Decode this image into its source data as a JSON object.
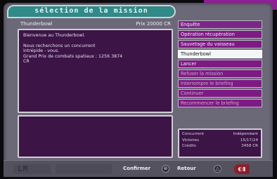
{
  "screen": {
    "title": "sélection de la mission"
  },
  "mission": {
    "name": "Thunderbowl",
    "prize": "Prix 20000 CR",
    "description": [
      "Bienvenue au Thunderbowl.",
      "Nous recherchons un concurrent\nintrépide - vous.\nGrand Prix de combats spatiaux : 1256 3874\nCR"
    ]
  },
  "menu": {
    "items": [
      {
        "label": "Enquête",
        "state": "header"
      },
      {
        "label": "Opération récupération",
        "state": "normal"
      },
      {
        "label": "Sauvetage du vaisseau",
        "state": "normal"
      },
      {
        "label": "Thunderbowl",
        "state": "active"
      },
      {
        "label": "Lancer",
        "state": "normal"
      },
      {
        "label": "Refuser la mission",
        "state": "dim"
      },
      {
        "label": "Interrompre le briefing",
        "state": "dim"
      },
      {
        "label": "Continuer",
        "state": "dim"
      },
      {
        "label": "Recommencer le briefing",
        "state": "dim"
      }
    ]
  },
  "stats": [
    {
      "label": "Concurrent",
      "value": "Indépendant"
    },
    {
      "label": "Victoires",
      "value": "15/17/24"
    },
    {
      "label": "Crédits",
      "value": "3458 CR"
    }
  ],
  "footer": {
    "logo": "LM",
    "confirm_label": "Confirmer",
    "confirm_icon": "⊗",
    "back_label": "Retour",
    "back_icon": "△",
    "corner_icon": "◐▮"
  },
  "colors": {
    "panel": "#3c1446",
    "menu": "#7e1a83",
    "title_bar": "#2f8a88",
    "accent": "#8e1f95"
  }
}
